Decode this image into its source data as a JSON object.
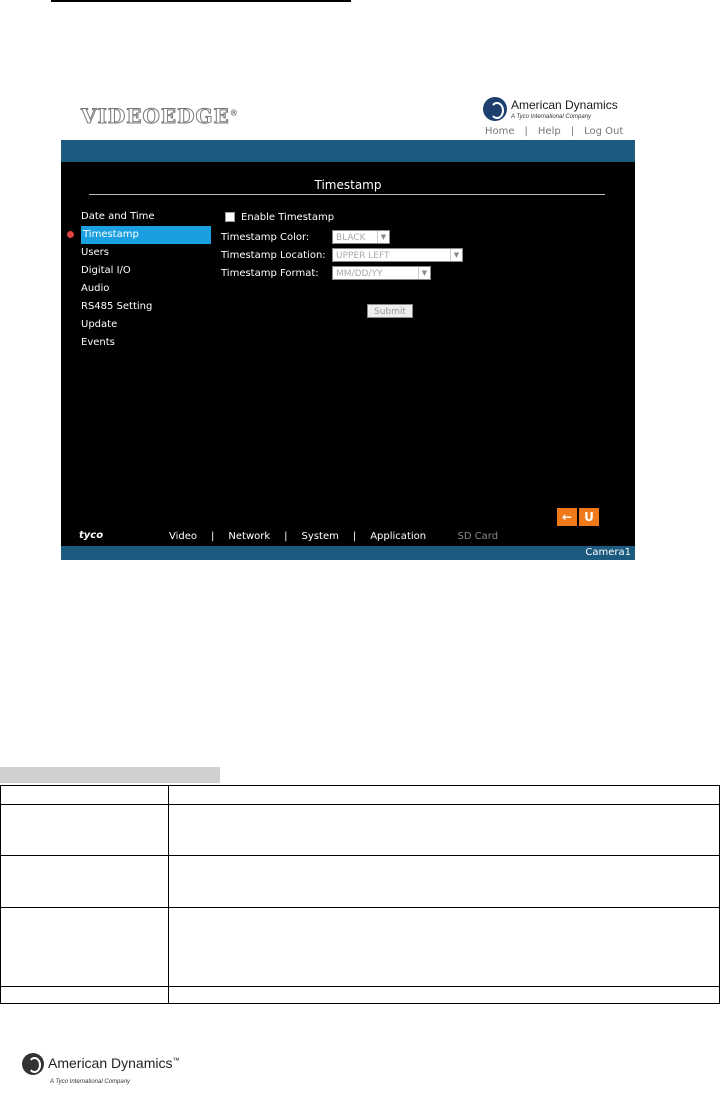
{
  "header": {
    "product_logo": "VIDEOEDGE",
    "product_logo_mark": "®",
    "brand_name": "American Dynamics",
    "brand_tagline": "A Tyco International Company",
    "links": [
      "Home",
      "|",
      "Help",
      "|",
      "Log Out"
    ]
  },
  "page": {
    "title": "Timestamp"
  },
  "sidebar": {
    "items": [
      {
        "label": "Date and Time",
        "active": false
      },
      {
        "label": "Timestamp",
        "active": true
      },
      {
        "label": "Users",
        "active": false
      },
      {
        "label": "Digital I/O",
        "active": false
      },
      {
        "label": "Audio",
        "active": false
      },
      {
        "label": "RS485 Setting",
        "active": false
      },
      {
        "label": "Update",
        "active": false
      },
      {
        "label": "Events",
        "active": false
      }
    ]
  },
  "form": {
    "enable_label": "Enable Timestamp",
    "color_label": "Timestamp Color:",
    "color_value": "BLACK",
    "location_label": "Timestamp Location:",
    "location_value": "UPPER LEFT",
    "format_label": "Timestamp Format:",
    "format_value": "MM/DD/YY",
    "submit_label": "Submit"
  },
  "nav_buttons": {
    "back_icon": "←",
    "refresh_icon": "U"
  },
  "bottom_nav": {
    "brand": "tyco",
    "items": [
      "Video",
      "Network",
      "System",
      "Application",
      "SD Card"
    ]
  },
  "camera": {
    "name": "Camera1"
  },
  "footer": {
    "brand_name": "American Dynamics",
    "brand_mark": "™",
    "brand_tagline": "A Tyco International Company"
  }
}
